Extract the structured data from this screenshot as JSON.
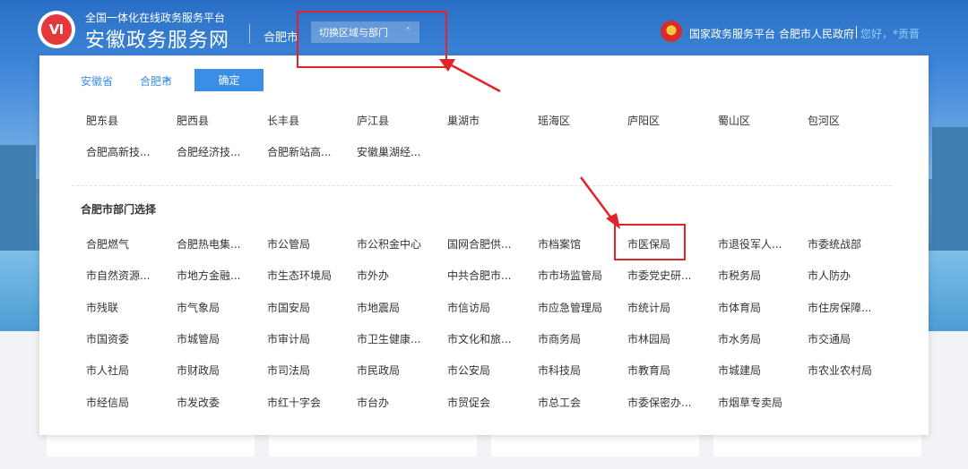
{
  "header": {
    "logo_glyph": "Ⅵ",
    "brand_subtitle": "全国一体化在线政务服务平台",
    "brand_title": "安徽政务服务网",
    "city": "合肥市",
    "switch_label": "切换区域与部门",
    "switch_chevron": "ˆ",
    "national_platform": "国家政务服务平台",
    "gov_name": "合肥市人民政府",
    "greeting": "您好，*贡晋"
  },
  "panel": {
    "breadcrumb": [
      "安徽省",
      "合肥市"
    ],
    "breadcrumb_sep": ">",
    "confirm_label": "确定",
    "regions": [
      "肥东县",
      "肥西县",
      "长丰县",
      "庐江县",
      "巢湖市",
      "瑶海区",
      "庐阳区",
      "蜀山区",
      "包河区",
      "合肥高新技...",
      "合肥经济技...",
      "合肥新站高...",
      "安徽巢湖经..."
    ],
    "dept_title": "合肥市部门选择",
    "departments": [
      "合肥燃气",
      "合肥热电集...",
      "市公管局",
      "市公积金中心",
      "国网合肥供...",
      "市档案馆",
      "市医保局",
      "市退役军人...",
      "市委统战部",
      "市自然资源...",
      "市地方金融...",
      "市生态环境局",
      "市外办",
      "中共合肥市...",
      "市市场监管局",
      "市委党史研...",
      "市税务局",
      "市人防办",
      "市残联",
      "市气象局",
      "市国安局",
      "市地震局",
      "市信访局",
      "市应急管理局",
      "市统计局",
      "市体育局",
      "市住房保障...",
      "市国资委",
      "市城管局",
      "市审计局",
      "市卫生健康...",
      "市文化和旅...",
      "市商务局",
      "市林园局",
      "市水务局",
      "市交通局",
      "市人社局",
      "市财政局",
      "市司法局",
      "市民政局",
      "市公安局",
      "市科技局",
      "市教育局",
      "市城建局",
      "市农业农村局",
      "市经信局",
      "市发改委",
      "市红十字会",
      "市台办",
      "市贸促会",
      "市总工会",
      "市委保密办...",
      "市烟草专卖局"
    ]
  },
  "colors": {
    "accent": "#3a8ee6",
    "annotation": "#e2232a"
  }
}
